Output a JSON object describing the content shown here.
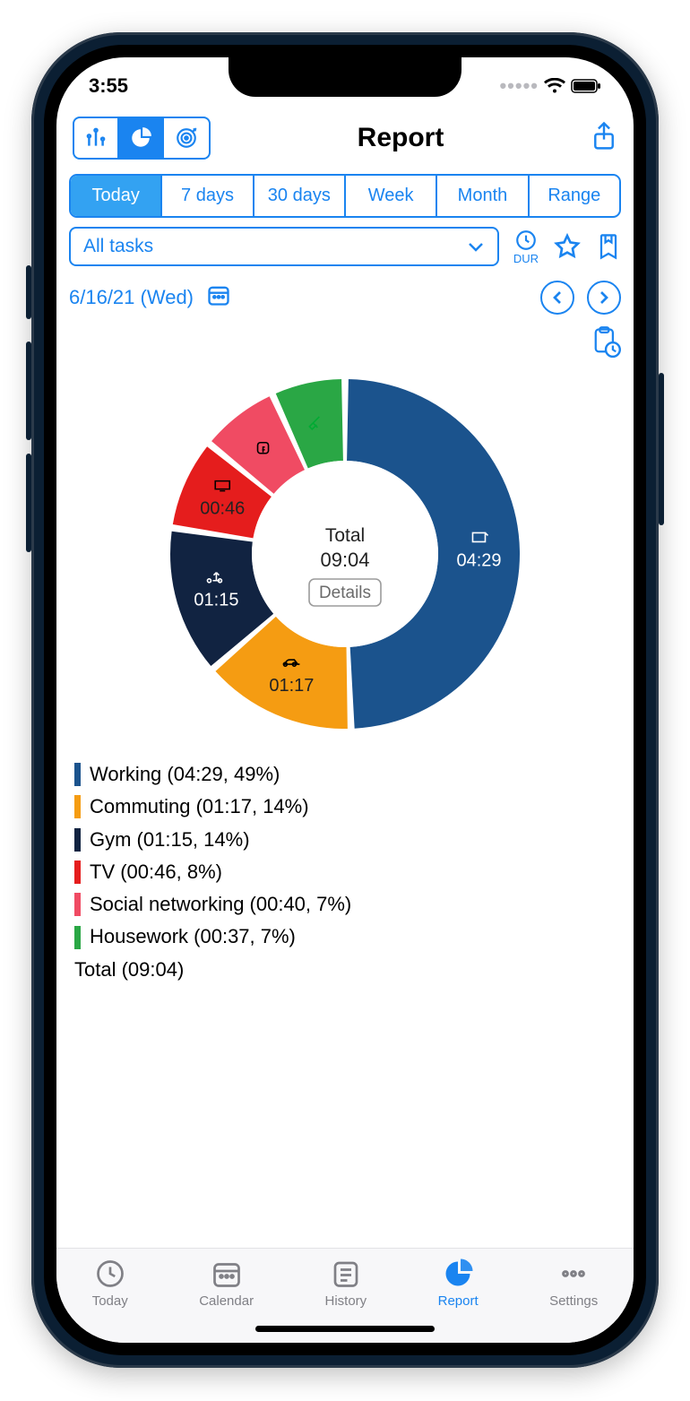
{
  "status_time": "3:55",
  "header": {
    "title": "Report"
  },
  "view_modes": {
    "bar": "bar-chart-icon",
    "pie": "pie-chart-icon",
    "target": "target-icon",
    "active": "pie"
  },
  "range_tabs": [
    "Today",
    "7 days",
    "30 days",
    "Week",
    "Month",
    "Range"
  ],
  "range_active": "Today",
  "task_filter": {
    "label": "All tasks"
  },
  "dur_label": "DUR",
  "date_label": "6/16/21 (Wed)",
  "chart_center": {
    "label": "Total",
    "value": "09:04",
    "details": "Details"
  },
  "chart_data": {
    "type": "pie",
    "title": "Report — Today — 6/16/21 (Wed)",
    "total_label": "Total (09:04)",
    "total_minutes": 544,
    "series": [
      {
        "name": "Working",
        "time": "04:29",
        "minutes": 269,
        "pct": 49,
        "color": "#1b538d",
        "label_in_slice": "04:29"
      },
      {
        "name": "Commuting",
        "time": "01:17",
        "minutes": 77,
        "pct": 14,
        "color": "#f59c12",
        "label_in_slice": "01:17"
      },
      {
        "name": "Gym",
        "time": "01:15",
        "minutes": 75,
        "pct": 14,
        "color": "#112341",
        "label_in_slice": "01:15"
      },
      {
        "name": "TV",
        "time": "00:46",
        "minutes": 46,
        "pct": 8,
        "color": "#e51d1d",
        "label_in_slice": "00:46"
      },
      {
        "name": "Social networking",
        "time": "00:40",
        "minutes": 40,
        "pct": 7,
        "color": "#f04b63",
        "label_in_slice": ""
      },
      {
        "name": "Housework",
        "time": "00:37",
        "minutes": 37,
        "pct": 7,
        "color": "#2aa745",
        "label_in_slice": ""
      }
    ]
  },
  "legend_items": [
    "Working (04:29, 49%)",
    "Commuting (01:17, 14%)",
    "Gym (01:15, 14%)",
    "TV (00:46, 8%)",
    "Social networking (00:40, 7%)",
    "Housework (00:37, 7%)"
  ],
  "navtabs": [
    {
      "label": "Today"
    },
    {
      "label": "Calendar"
    },
    {
      "label": "History"
    },
    {
      "label": "Report"
    },
    {
      "label": "Settings"
    }
  ],
  "nav_active": "Report"
}
